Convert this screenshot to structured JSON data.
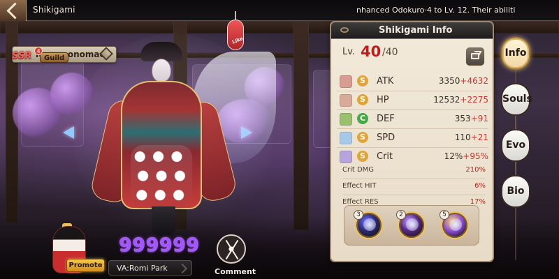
{
  "header": {
    "title": "Shikigami",
    "ticker": "nhanced Odokuro·4  to Lv. 12. Their abiliti"
  },
  "character": {
    "rarity": "SSR",
    "name": "Tamamonomae",
    "guild_label": "Guild",
    "guild_badge_count": "4",
    "lantern_tag": "Like"
  },
  "info_panel": {
    "title": "Shikigami Info",
    "level_label": "Lv.",
    "level_current": "40",
    "level_max": "/40",
    "stats": [
      {
        "label": "ATK",
        "grade": "S",
        "base": "3350",
        "bonus": "+4632",
        "icon": "atk-icon",
        "icon_color": "#d79d93",
        "grade_color": "#e0a43b"
      },
      {
        "label": "HP",
        "grade": "S",
        "base": "12532",
        "bonus": "+2275",
        "icon": "hp-icon",
        "icon_color": "#d8aa99",
        "grade_color": "#e0a43b"
      },
      {
        "label": "DEF",
        "grade": "C",
        "base": "353",
        "bonus": "+91",
        "icon": "def-icon",
        "icon_color": "#9ac06f",
        "grade_color": "#43a94b"
      },
      {
        "label": "SPD",
        "grade": "S",
        "base": "110",
        "bonus": "+21",
        "icon": "spd-icon",
        "icon_color": "#a6c8e9",
        "grade_color": "#e0a43b"
      },
      {
        "label": "Crit",
        "grade": "S",
        "base": "12%",
        "bonus": "+95%",
        "icon": "crit-icon",
        "icon_color": "#b8a4dc",
        "grade_color": "#e0a43b"
      }
    ],
    "secondary_stats": [
      {
        "label": "Crit DMG",
        "value": "210%"
      },
      {
        "label": "Effect HIT",
        "value": "6%"
      },
      {
        "label": "Effect RES",
        "value": "17%"
      }
    ],
    "skills": [
      {
        "cost": "3",
        "icon": "skill-icon"
      },
      {
        "cost": "2",
        "icon": "skill-icon"
      },
      {
        "cost": "5",
        "icon": "skill-icon"
      }
    ]
  },
  "side_tabs": [
    {
      "label": "Info",
      "active": true
    },
    {
      "label": "Souls",
      "active": false
    },
    {
      "label": "Evo",
      "active": false
    },
    {
      "label": "Bio",
      "active": false
    }
  ],
  "bottom": {
    "promote_label": "Promote",
    "score": "999999",
    "voice_actor": "VA:Romi Park",
    "comment_label": "Comment"
  }
}
